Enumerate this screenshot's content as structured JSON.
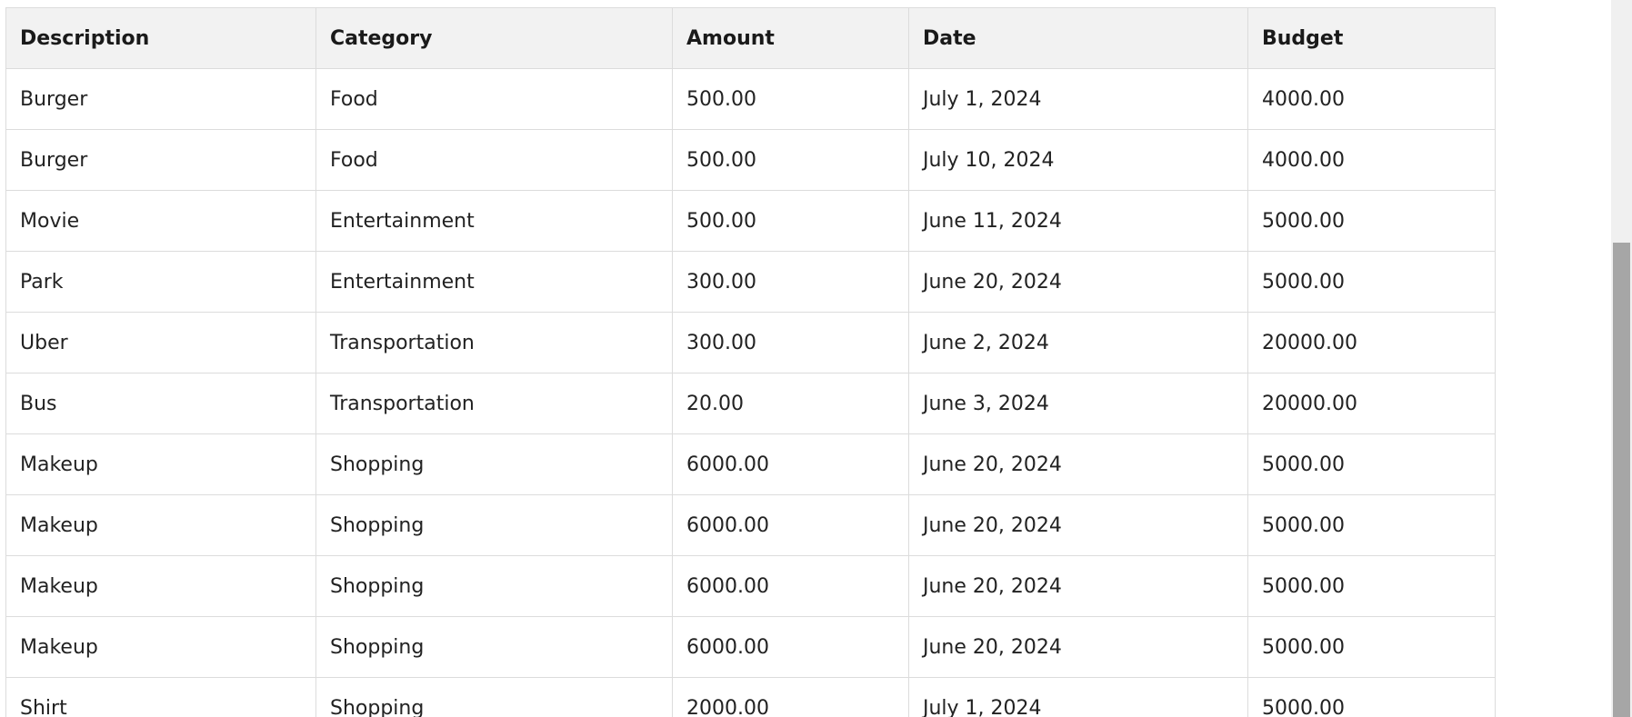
{
  "table": {
    "headers": {
      "description": "Description",
      "category": "Category",
      "amount": "Amount",
      "date": "Date",
      "budget": "Budget"
    },
    "rows": [
      {
        "description": "Burger",
        "category": "Food",
        "amount": "500.00",
        "date": "July 1, 2024",
        "budget": "4000.00"
      },
      {
        "description": "Burger",
        "category": "Food",
        "amount": "500.00",
        "date": "July 10, 2024",
        "budget": "4000.00"
      },
      {
        "description": "Movie",
        "category": "Entertainment",
        "amount": "500.00",
        "date": "June 11, 2024",
        "budget": "5000.00"
      },
      {
        "description": "Park",
        "category": "Entertainment",
        "amount": "300.00",
        "date": "June 20, 2024",
        "budget": "5000.00"
      },
      {
        "description": "Uber",
        "category": "Transportation",
        "amount": "300.00",
        "date": "June 2, 2024",
        "budget": "20000.00"
      },
      {
        "description": "Bus",
        "category": "Transportation",
        "amount": "20.00",
        "date": "June 3, 2024",
        "budget": "20000.00"
      },
      {
        "description": "Makeup",
        "category": "Shopping",
        "amount": "6000.00",
        "date": "June 20, 2024",
        "budget": "5000.00"
      },
      {
        "description": "Makeup",
        "category": "Shopping",
        "amount": "6000.00",
        "date": "June 20, 2024",
        "budget": "5000.00"
      },
      {
        "description": "Makeup",
        "category": "Shopping",
        "amount": "6000.00",
        "date": "June 20, 2024",
        "budget": "5000.00"
      },
      {
        "description": "Makeup",
        "category": "Shopping",
        "amount": "6000.00",
        "date": "June 20, 2024",
        "budget": "5000.00"
      },
      {
        "description": "Shirt",
        "category": "Shopping",
        "amount": "2000.00",
        "date": "July 1, 2024",
        "budget": "5000.00"
      }
    ]
  },
  "colors": {
    "header_background": "#f2f2f2",
    "border": "#dcdcdc",
    "scrollbar_track": "#f0f0f0",
    "scrollbar_thumb": "#a6a6a6"
  }
}
